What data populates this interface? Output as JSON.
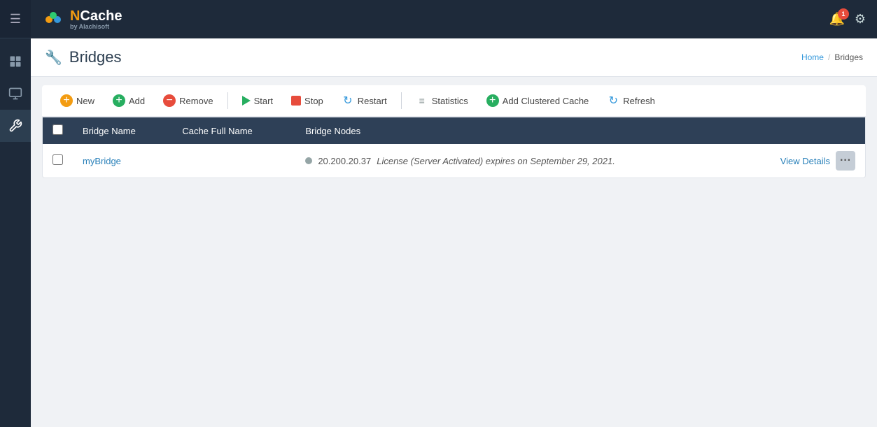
{
  "app": {
    "title": "NCache",
    "subtitle": "by Alachisoft"
  },
  "topbar": {
    "notifications_count": "1",
    "settings_label": "Settings"
  },
  "sidebar": {
    "items": [
      {
        "name": "menu-toggle",
        "icon": "hamburger"
      },
      {
        "name": "dashboard",
        "icon": "dashboard"
      },
      {
        "name": "monitor",
        "icon": "monitor"
      },
      {
        "name": "tools",
        "icon": "tools"
      }
    ]
  },
  "page": {
    "title": "Bridges",
    "icon": "wrench"
  },
  "breadcrumb": {
    "home_label": "Home",
    "separator": "/",
    "current": "Bridges"
  },
  "toolbar": {
    "new_label": "New",
    "add_label": "Add",
    "remove_label": "Remove",
    "start_label": "Start",
    "stop_label": "Stop",
    "restart_label": "Restart",
    "statistics_label": "Statistics",
    "add_clustered_cache_label": "Add Clustered Cache",
    "refresh_label": "Refresh"
  },
  "table": {
    "columns": [
      {
        "key": "checkbox",
        "label": ""
      },
      {
        "key": "bridge_name",
        "label": "Bridge Name"
      },
      {
        "key": "cache_full_name",
        "label": "Cache Full Name"
      },
      {
        "key": "bridge_nodes",
        "label": "Bridge Nodes"
      }
    ],
    "rows": [
      {
        "bridge_name": "myBridge",
        "cache_full_name": "",
        "ip": "20.200.20.37",
        "license": "License (Server Activated) expires on September 29, 2021.",
        "view_details_label": "View Details",
        "status": "inactive"
      }
    ]
  }
}
